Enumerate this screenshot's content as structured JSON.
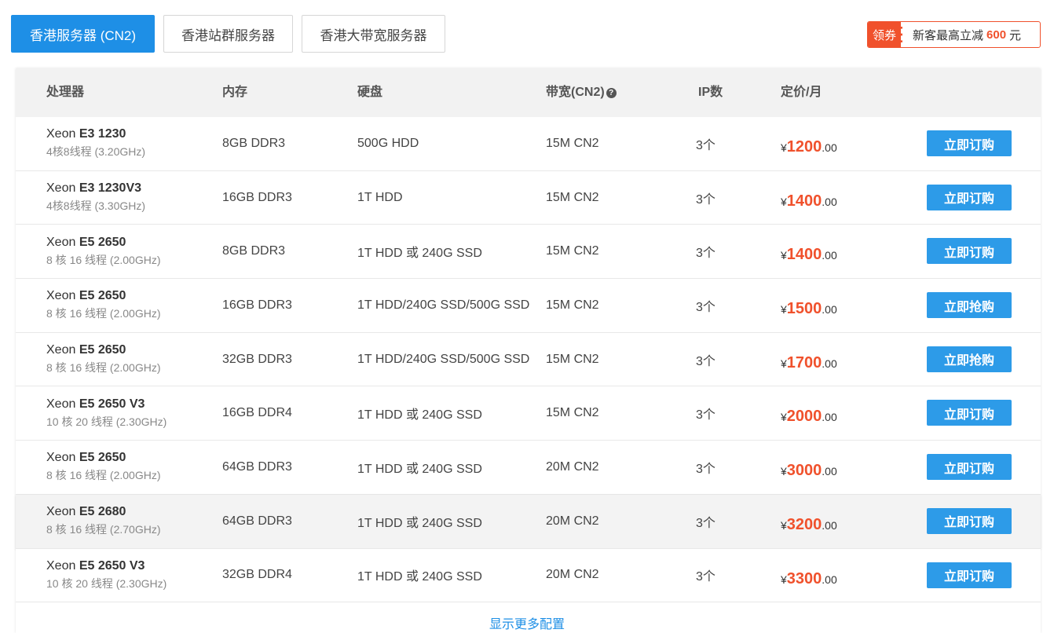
{
  "tabs": [
    {
      "label": "香港服务器 (CN2)",
      "active": true
    },
    {
      "label": "香港站群服务器",
      "active": false
    },
    {
      "label": "香港大带宽服务器",
      "active": false
    }
  ],
  "coupon": {
    "tag": "领券",
    "text": "新客最高立减",
    "amount": "600",
    "unit": "元"
  },
  "headers": {
    "cpu": "处理器",
    "ram": "内存",
    "disk": "硬盘",
    "bandwidth": "带宽(CN2)",
    "ip": "IP数",
    "price": "定价/月"
  },
  "rows": [
    {
      "brand": "Xeon",
      "model": "E3 1230",
      "spec": "4核8线程 (3.20GHz)",
      "ram": "8GB DDR3",
      "disk": "500G HDD",
      "bw": "15M CN2",
      "ip": "3个",
      "currency": "¥",
      "price": "1200",
      "cents": ".00",
      "btn": "立即订购"
    },
    {
      "brand": "Xeon",
      "model": "E3 1230V3",
      "spec": "4核8线程 (3.30GHz)",
      "ram": "16GB DDR3",
      "disk": "1T HDD",
      "bw": "15M CN2",
      "ip": "3个",
      "currency": "¥",
      "price": "1400",
      "cents": ".00",
      "btn": "立即订购"
    },
    {
      "brand": "Xeon",
      "model": "E5 2650",
      "spec": "8 核 16 线程 (2.00GHz)",
      "ram": "8GB DDR3",
      "disk": "1T HDD 或 240G SSD",
      "bw": "15M CN2",
      "ip": "3个",
      "currency": "¥",
      "price": "1400",
      "cents": ".00",
      "btn": "立即订购"
    },
    {
      "brand": "Xeon",
      "model": "E5 2650",
      "spec": "8 核 16 线程 (2.00GHz)",
      "ram": "16GB DDR3",
      "disk": "1T HDD/240G SSD/500G SSD",
      "bw": "15M CN2",
      "ip": "3个",
      "currency": "¥",
      "price": "1500",
      "cents": ".00",
      "btn": "立即抢购"
    },
    {
      "brand": "Xeon",
      "model": "E5 2650",
      "spec": "8 核 16 线程 (2.00GHz)",
      "ram": "32GB DDR3",
      "disk": "1T HDD/240G SSD/500G SSD",
      "bw": "15M CN2",
      "ip": "3个",
      "currency": "¥",
      "price": "1700",
      "cents": ".00",
      "btn": "立即抢购"
    },
    {
      "brand": "Xeon",
      "model": "E5 2650 V3",
      "spec": "10 核 20 线程 (2.30GHz)",
      "ram": "16GB DDR4",
      "disk": "1T HDD 或 240G SSD",
      "bw": "15M CN2",
      "ip": "3个",
      "currency": "¥",
      "price": "2000",
      "cents": ".00",
      "btn": "立即订购"
    },
    {
      "brand": "Xeon",
      "model": "E5 2650",
      "spec": "8 核 16 线程 (2.00GHz)",
      "ram": "64GB DDR3",
      "disk": "1T HDD 或 240G SSD",
      "bw": "20M CN2",
      "ip": "3个",
      "currency": "¥",
      "price": "3000",
      "cents": ".00",
      "btn": "立即订购"
    },
    {
      "brand": "Xeon",
      "model": "E5 2680",
      "spec": "8 核 16 线程 (2.70GHz)",
      "ram": "64GB DDR3",
      "disk": "1T HDD 或 240G SSD",
      "bw": "20M CN2",
      "ip": "3个",
      "currency": "¥",
      "price": "3200",
      "cents": ".00",
      "btn": "立即订购",
      "highlight": true
    },
    {
      "brand": "Xeon",
      "model": "E5 2650 V3",
      "spec": "10 核 20 线程 (2.30GHz)",
      "ram": "32GB DDR4",
      "disk": "1T HDD 或 240G SSD",
      "bw": "20M CN2",
      "ip": "3个",
      "currency": "¥",
      "price": "3300",
      "cents": ".00",
      "btn": "立即订购"
    }
  ],
  "more_label": "显示更多配置",
  "colors": {
    "accent": "#1e8fe6",
    "button": "#2d9be8",
    "price": "#f0512c",
    "coupon": "#f0512c"
  }
}
